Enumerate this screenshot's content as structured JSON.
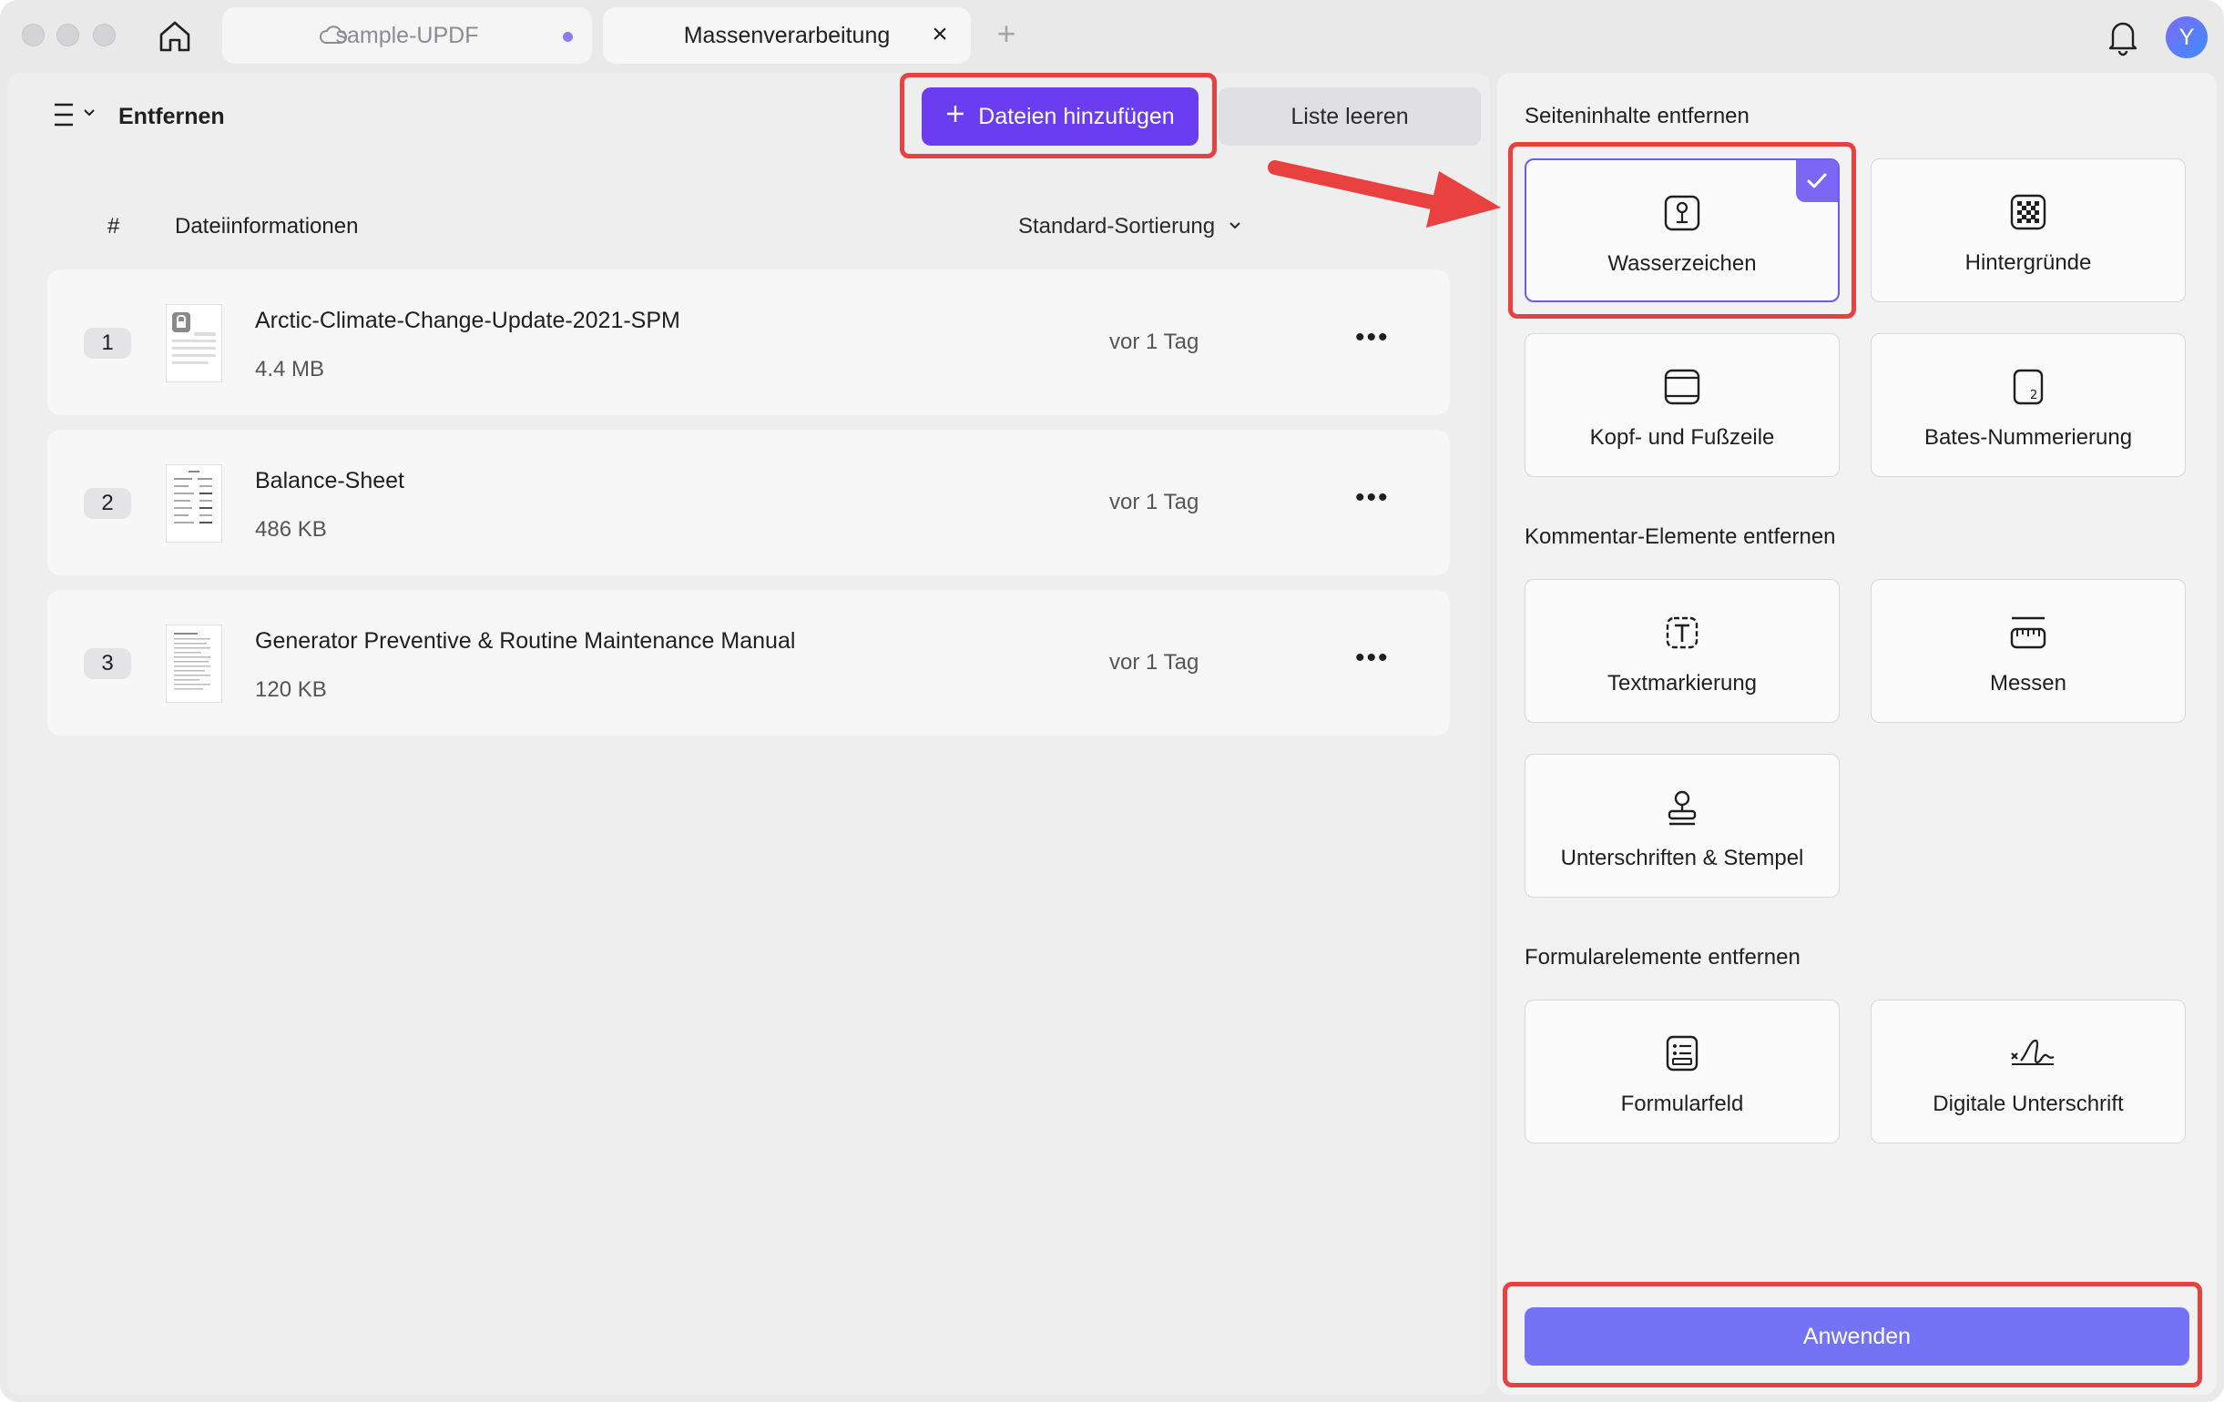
{
  "tabs": [
    {
      "label": "sample-UPDF",
      "icon": "cloud-icon"
    },
    {
      "label": "Massenverarbeitung",
      "close": "×"
    }
  ],
  "new_tab": "+",
  "avatar_letter": "Y",
  "left": {
    "title": "Entfernen",
    "add_button": "Dateien hinzufügen",
    "clear_button": "Liste leeren",
    "columns": {
      "hash": "#",
      "info": "Dateiinformationen",
      "sort": "Standard-Sortierung"
    },
    "files": [
      {
        "index": "1",
        "name": "Arctic-Climate-Change-Update-2021-SPM",
        "size": "4.4 MB",
        "date": "vor 1 Tag",
        "locked": true
      },
      {
        "index": "2",
        "name": "Balance-Sheet",
        "size": "486 KB",
        "date": "vor 1 Tag",
        "locked": false
      },
      {
        "index": "3",
        "name": "Generator Preventive & Routine Maintenance Manual",
        "size": "120 KB",
        "date": "vor 1 Tag",
        "locked": false
      }
    ]
  },
  "right": {
    "sections": [
      {
        "title": "Seiteninhalte entfernen",
        "items": [
          {
            "label": "Wasserzeichen",
            "icon": "watermark-icon",
            "selected": true
          },
          {
            "label": "Hintergründe",
            "icon": "background-icon",
            "selected": false
          },
          {
            "label": "Kopf- und Fußzeile",
            "icon": "header-footer-icon",
            "selected": false
          },
          {
            "label": "Bates-Nummerierung",
            "icon": "bates-icon",
            "selected": false
          }
        ]
      },
      {
        "title": "Kommentar-Elemente entfernen",
        "items": [
          {
            "label": "Textmarkierung",
            "icon": "text-markup-icon",
            "selected": false
          },
          {
            "label": "Messen",
            "icon": "measure-icon",
            "selected": false
          },
          {
            "label": "Unterschriften & Stempel",
            "icon": "stamp-icon",
            "selected": false
          }
        ]
      },
      {
        "title": "Formularelemente entfernen",
        "items": [
          {
            "label": "Formularfeld",
            "icon": "form-field-icon",
            "selected": false
          },
          {
            "label": "Digitale Unterschrift",
            "icon": "digital-signature-icon",
            "selected": false
          }
        ]
      }
    ],
    "apply_button": "Anwenden"
  },
  "colors": {
    "accent": "#6a3df0",
    "apply": "#7473f5",
    "highlight": "#e8413f"
  }
}
